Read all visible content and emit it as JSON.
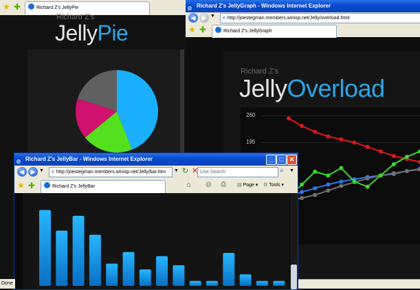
{
  "pie_window": {
    "tab_label": "Richard Z's JellyPie",
    "author": "Richard Z's",
    "title_part1": "Jelly",
    "title_part2": "Pie",
    "chart_data": {
      "type": "pie",
      "slices": [
        {
          "value": 44,
          "color": "#1ab0ff"
        },
        {
          "value": 20,
          "color": "#55e01e"
        },
        {
          "value": 16,
          "color": "#d0106e"
        },
        {
          "value": 20,
          "color": "#606060"
        }
      ]
    }
  },
  "graph_window": {
    "window_title": "Richard Z's JellyGraph - Windows Internet Explorer",
    "address_url": "http://joestegman.members.winisp.net/Jelly/overload.html",
    "tab_label": "Richard Z's JellyGraph",
    "author": "Richard Z's",
    "title_part1": "Jelly",
    "title_part2": "Overload",
    "chart_data": {
      "type": "line",
      "y_ticks": [
        "260",
        "195"
      ],
      "series": [
        {
          "color": "#e01818",
          "values": [
            256,
            246,
            238,
            232,
            228,
            224,
            218,
            212,
            206,
            202,
            198
          ]
        },
        {
          "color": "#2a78e8",
          "values": [
            152,
            158,
            163,
            168,
            172,
            175,
            178,
            180,
            182,
            186,
            189
          ]
        },
        {
          "color": "#707070",
          "values": [
            146,
            150,
            154,
            160,
            166,
            171,
            176,
            180,
            183,
            186,
            188
          ]
        },
        {
          "color": "#38d830",
          "values": [
            150,
            168,
            185,
            180,
            190,
            172,
            165,
            180,
            195,
            205,
            212
          ]
        }
      ]
    }
  },
  "bar_window": {
    "window_title": "Richard Z's JellyBar - Windows Internet Explorer",
    "address_url": "http://joestegman.members.winisp.net/Jelly/bar.htm",
    "search_placeholder": "Live Search",
    "tab_label": "Richard Z's JellyBar",
    "page_label": "Page",
    "tools_label": "Tools",
    "chart_data": {
      "type": "bar",
      "color": "#1aa8ff",
      "values": [
        92,
        67,
        85,
        62,
        27,
        41,
        20,
        36,
        25,
        6,
        6,
        40,
        14,
        6,
        6
      ]
    }
  },
  "status_bar": {
    "done_label": "Done"
  }
}
